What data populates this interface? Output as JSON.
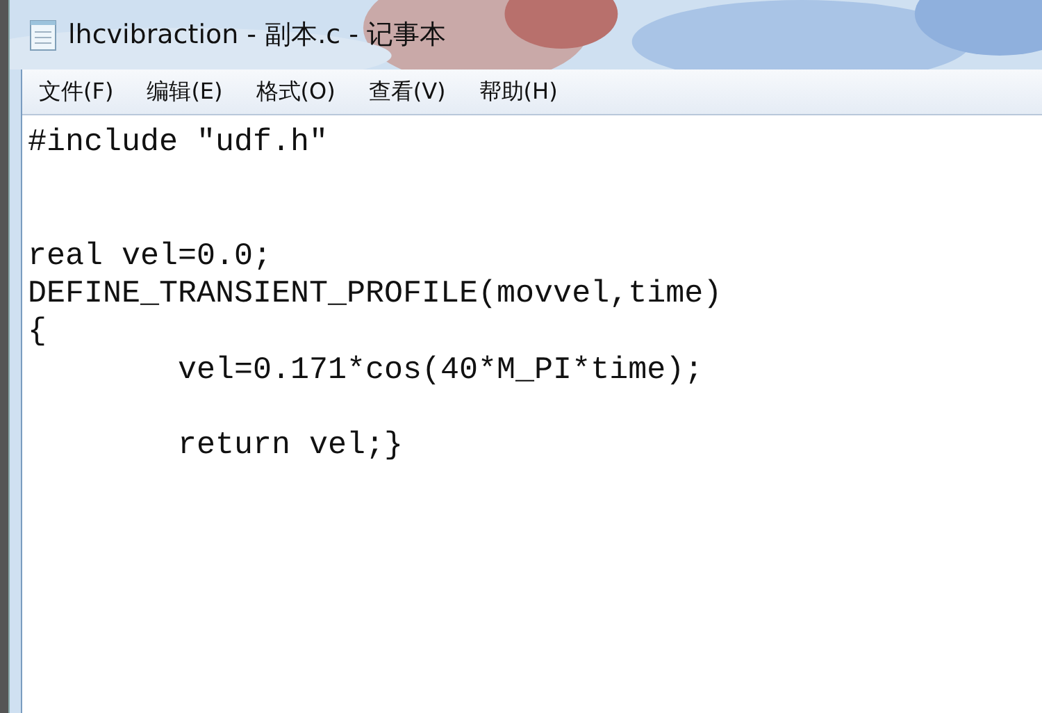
{
  "window": {
    "title": "lhcvibraction - 副本.c - 记事本"
  },
  "menu": [
    "文件(F)",
    "编辑(E)",
    "格式(O)",
    "查看(V)",
    "帮助(H)"
  ],
  "editor": {
    "text": "#include ″udf.h″\n\n\nreal vel=0.0;\nDEFINE_TRANSIENT_PROFILE(movvel,time)\n{\n        vel=0.171*cos(40*M_PI*time);\n\n        return vel;}"
  }
}
